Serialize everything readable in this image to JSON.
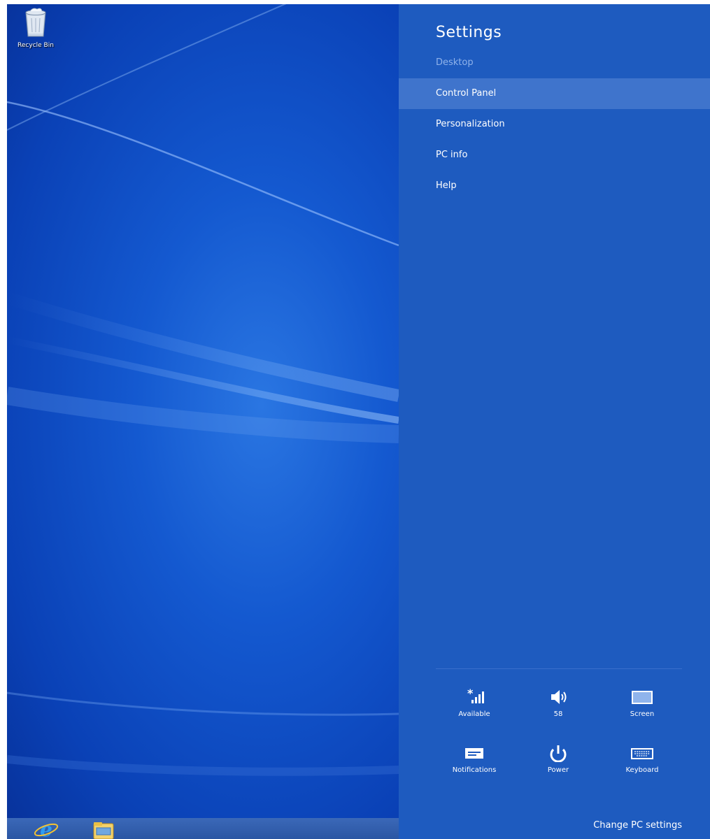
{
  "desktop": {
    "icons": [
      {
        "label": "Recycle Bin",
        "icon": "recycle-bin-icon"
      }
    ],
    "taskbar": {
      "pinned": [
        {
          "icon": "internet-explorer-icon"
        },
        {
          "icon": "file-explorer-icon"
        }
      ]
    }
  },
  "settings": {
    "title": "Settings",
    "subtitle": "Desktop",
    "items": [
      {
        "label": "Control Panel",
        "active": true
      },
      {
        "label": "Personalization",
        "active": false
      },
      {
        "label": "PC info",
        "active": false
      },
      {
        "label": "Help",
        "active": false
      }
    ],
    "quick_settings": [
      {
        "label": "Available",
        "icon": "network-icon"
      },
      {
        "label": "58",
        "icon": "volume-icon"
      },
      {
        "label": "Screen",
        "icon": "screen-brightness-icon"
      },
      {
        "label": "Notifications",
        "icon": "notifications-icon"
      },
      {
        "label": "Power",
        "icon": "power-icon"
      },
      {
        "label": "Keyboard",
        "icon": "keyboard-icon"
      }
    ],
    "change_pc_settings": "Change PC settings"
  },
  "colors": {
    "pane_background": "#1e5bbf",
    "active_item": "#3f74cc",
    "subtitle": "#8fb2ea",
    "wallpaper": "#1459d0"
  }
}
